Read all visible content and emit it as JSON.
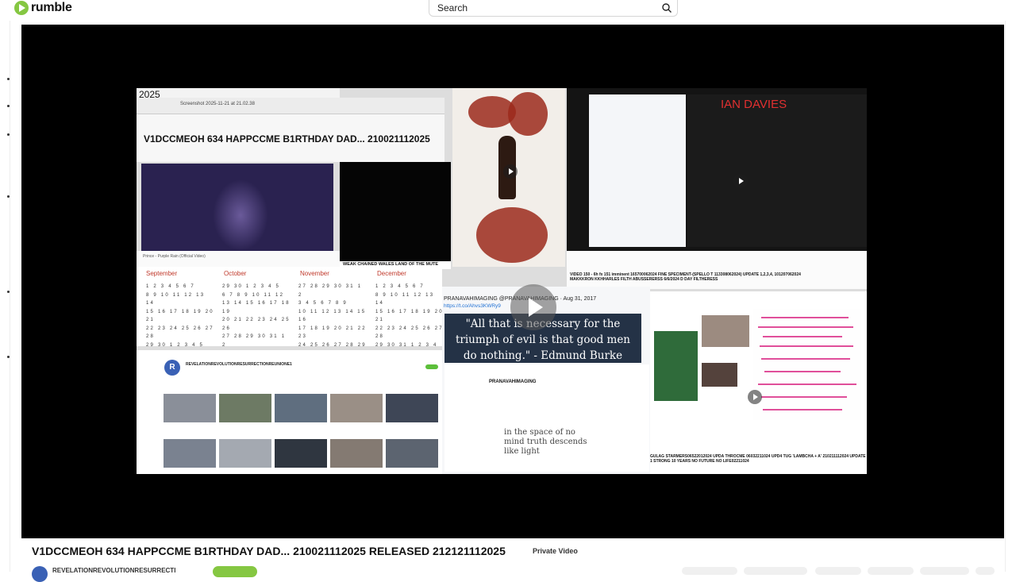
{
  "header": {
    "logo_text": "rumble",
    "search_placeholder": "Search"
  },
  "player": {
    "collage": {
      "year": "2025",
      "screenshot_bar": "Screenshot 2025-11-21 at 21.02.38",
      "title_banner": "V1DCCMEOH 634 HAPPCCME B1RTHDAY DAD... 210021112025",
      "video_meta": "Prince - Purple Rain (Official Video)",
      "weak_chained_caption": "WEAK CHAINED WALES LAND OF THE MUTE",
      "handwritten_note": "IAN DAVIES",
      "video150_caption": "VIDEO 150 - 6h fx 151 imminent 165700062024 FINE SPECIMENT-(SPELLO T 113308062024) UPDATE 1,2,3,4, 101207062024 MAKKKRON KKHHARLES FILTH ABUSSERERSS 6/6/2024 D DAY FILTHERESS",
      "calendar_months": [
        "September",
        "October",
        "November",
        "December"
      ],
      "channel_header": "REVELATIONREVOLUTIONRESURRECTIONREUNIONE1",
      "tweet_handle": "PRANAVAHIMAGING @PRANAVAHIMAGING · Aug 31, 2017",
      "tweet_link": "https://t.co/Ahvs3KWRy9",
      "quote": "\"All that is necessary for the triumph of evil is that good men do nothing.\" - Edmund Burke",
      "profile_name": "PRANAVAHIMAGING",
      "quote2": "in the space of no mind truth descends like light",
      "lower_caption": "GULAG STARMERS06522012024 UPDA THROCME 06032211024 UPD4 TUG 'LAMBCHA + A' 210211112024 UPDATE 1 STRONG 10 YEARS NO FUTURE NO LIFE02211024"
    }
  },
  "video_info": {
    "title": "V1DCCMEOH 634 HAPPCCME B1RTHDAY DAD... 210021112025 RELEASED 212121112025",
    "private_label": "Private Video",
    "channel_name": "REVELATIONREVOLUTIONRESURRECTI"
  },
  "colors": {
    "brand_green": "#85c742",
    "player_bg": "#000000"
  }
}
